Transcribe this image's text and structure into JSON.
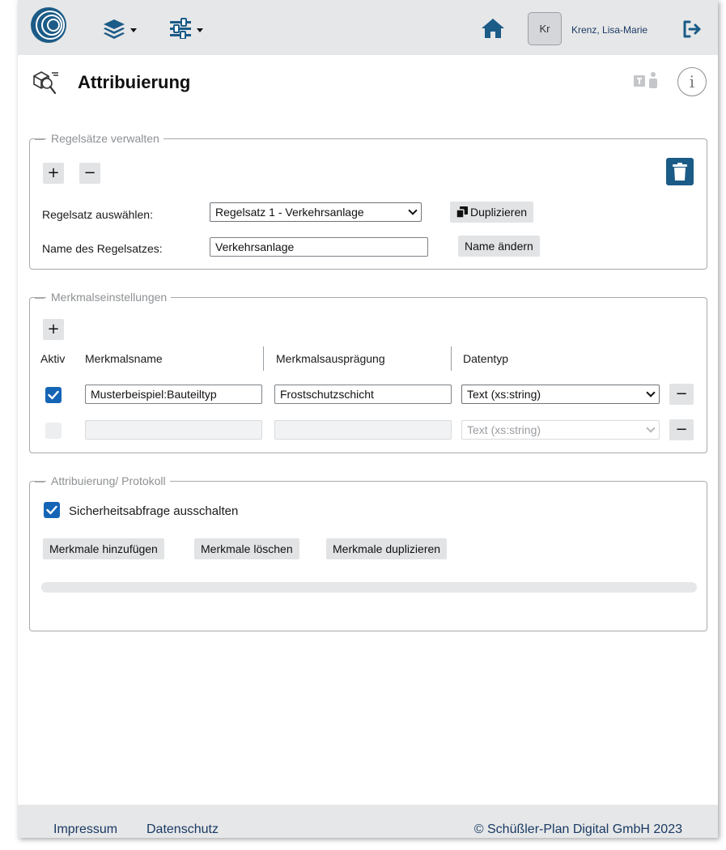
{
  "topbar": {
    "avatar_initials": "Kr",
    "user_name": "Krenz, Lisa-Marie",
    "icons": [
      "company-logo",
      "layers-icon",
      "sliders-icon",
      "home-icon",
      "logout-icon"
    ]
  },
  "header": {
    "title": "Attribuierung",
    "icons": [
      "attribution-icon",
      "teams-icon",
      "info-icon"
    ],
    "info_glyph": "i"
  },
  "rulesets": {
    "legend": "Regelsätze verwalten",
    "add_label": "+",
    "remove_label": "−",
    "select_label": "Regelsatz auswählen:",
    "selected_ruleset": "Regelsatz 1 - Verkehrsanlage",
    "duplicate_label": "Duplizieren",
    "name_label": "Name des Regelsatzes:",
    "name_value": "Verkehrsanlage",
    "rename_label": "Name ändern"
  },
  "features": {
    "legend": "Merkmalseinstellungen",
    "add_label": "+",
    "columns": [
      "Aktiv",
      "Merkmalsname",
      "Merkmalsausprägung",
      "Datentyp"
    ],
    "rows": [
      {
        "active": true,
        "name": "Musterbeispiel:Bauteiltyp",
        "value": "Frostschutzschicht",
        "datatype": "Text (xs:string)",
        "remove_label": "−",
        "enabled": true
      },
      {
        "active": false,
        "name": "",
        "value": "",
        "datatype": "Text (xs:string)",
        "remove_label": "−",
        "enabled": false
      }
    ]
  },
  "protocol": {
    "legend": "Attribuierung/ Protokoll",
    "safety_check_label": "Sicherheitsabfrage ausschalten",
    "safety_check_checked": true,
    "buttons": {
      "add": "Merkmale hinzufügen",
      "delete": "Merkmale löschen",
      "duplicate": "Merkmale duplizieren"
    },
    "progress_fraction": 0
  },
  "footer": {
    "impressum": "Impressum",
    "datenschutz": "Datenschutz",
    "copyright": "© Schüßler-Plan Digital GmbH 2023"
  },
  "colors": {
    "accent": "#1565b6",
    "trash": "#1b5b87",
    "bar": "#e6e7e8",
    "link": "#1a3a64"
  }
}
